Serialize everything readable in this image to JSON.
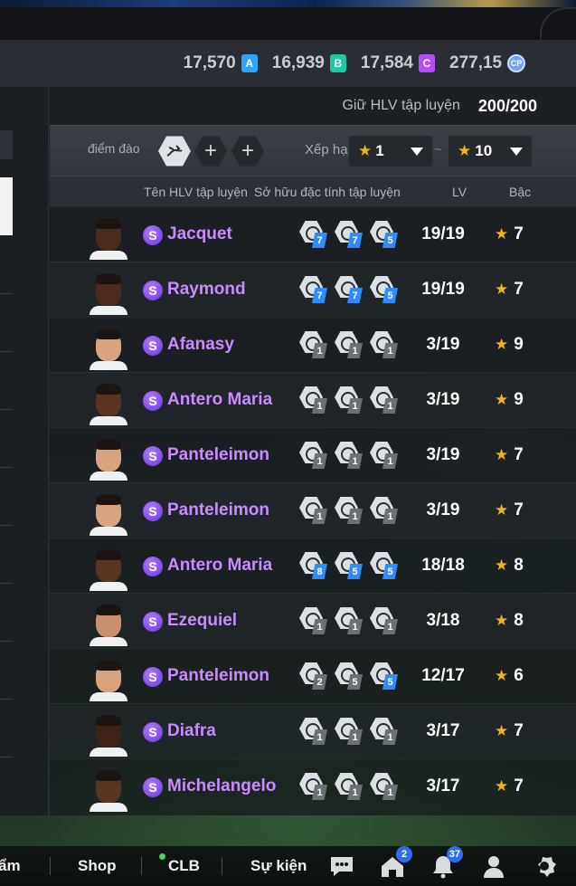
{
  "currencies": [
    {
      "value": "17,570",
      "badge": "A",
      "type": "a"
    },
    {
      "value": "16,939",
      "badge": "B",
      "type": "b"
    },
    {
      "value": "17,584",
      "badge": "C",
      "type": "c"
    },
    {
      "value": "277,15",
      "badge": "CP",
      "type": "coin"
    }
  ],
  "header": {
    "hlv_label": "Giữ HLV tập luyện",
    "hlv_value": "200/200"
  },
  "filter": {
    "label": "điểm đào",
    "rank_label": "Xếp hạ",
    "rank_from": "1",
    "rank_to": "10",
    "tilde": "~"
  },
  "columns": {
    "name": "Tên HLV tập luyện",
    "traits": "Sở hữu đặc tính tập luyện",
    "lv": "LV",
    "grade": "Bậc"
  },
  "rows": [
    {
      "name": "Jacquet",
      "traits": [
        "7",
        "7",
        "5"
      ],
      "trait_style": "blue",
      "lv": "19/19",
      "grade": "7",
      "skin": "#4a2b1c"
    },
    {
      "name": "Raymond",
      "traits": [
        "7",
        "7",
        "5"
      ],
      "trait_style": "blue",
      "lv": "19/19",
      "grade": "7",
      "skin": "#4a2b1c"
    },
    {
      "name": "Afanasy",
      "traits": [
        "1",
        "1",
        "1"
      ],
      "trait_style": "gray",
      "lv": "3/19",
      "grade": "9",
      "skin": "#d7a47f"
    },
    {
      "name": "Antero Maria",
      "traits": [
        "1",
        "1",
        "1"
      ],
      "trait_style": "gray",
      "lv": "3/19",
      "grade": "9",
      "skin": "#5a3422"
    },
    {
      "name": "Panteleimon",
      "traits": [
        "1",
        "1",
        "1"
      ],
      "trait_style": "gray",
      "lv": "3/19",
      "grade": "7",
      "skin": "#d7a47f"
    },
    {
      "name": "Panteleimon",
      "traits": [
        "1",
        "1",
        "1"
      ],
      "trait_style": "gray",
      "lv": "3/19",
      "grade": "7",
      "skin": "#d7a47f"
    },
    {
      "name": "Antero Maria",
      "traits": [
        "8",
        "5",
        "5"
      ],
      "trait_style": "blue",
      "lv": "18/18",
      "grade": "8",
      "skin": "#5a3422"
    },
    {
      "name": "Ezequiel",
      "traits": [
        "1",
        "1",
        "1"
      ],
      "trait_style": "gray",
      "lv": "3/18",
      "grade": "8",
      "skin": "#c99170"
    },
    {
      "name": "Panteleimon",
      "traits": [
        "2",
        "5",
        "5"
      ],
      "trait_style": "mixed",
      "lv": "12/17",
      "grade": "6",
      "skin": "#d7a47f"
    },
    {
      "name": "Diafra",
      "traits": [
        "1",
        "1",
        "1"
      ],
      "trait_style": "gray",
      "lv": "3/17",
      "grade": "7",
      "skin": "#3e2417"
    },
    {
      "name": "Michelangelo",
      "traits": [
        "1",
        "1",
        "1"
      ],
      "trait_style": "gray",
      "lv": "3/17",
      "grade": "7",
      "skin": "#5a3422"
    }
  ],
  "bottom_nav": {
    "partial": "ẩm",
    "shop": "Shop",
    "clb": "CLB",
    "su_kien": "Sự kiện",
    "home_badge": "2",
    "notif_badge": "37"
  },
  "colors": {
    "accent_purple": "#c98bff",
    "star": "#f0b322",
    "blue_level": "#2f8cff"
  }
}
